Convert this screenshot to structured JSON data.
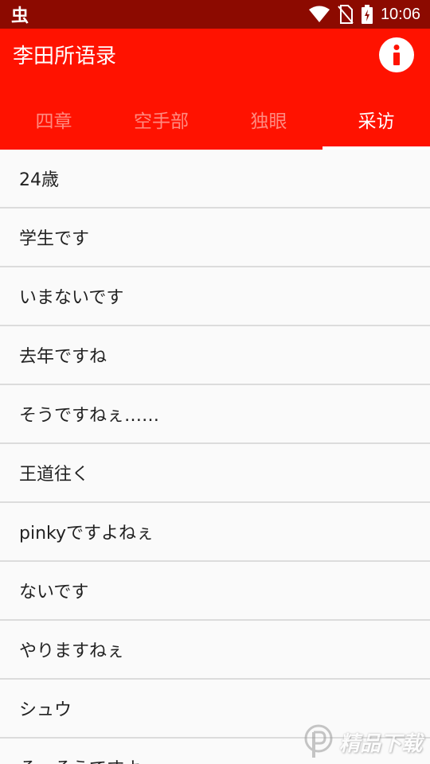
{
  "status_bar": {
    "notification_icon": "虫",
    "time": "10:06"
  },
  "app": {
    "title": "李田所语录",
    "info_icon": "info-icon"
  },
  "tabs": [
    {
      "label": "四章",
      "active": false
    },
    {
      "label": "空手部",
      "active": false
    },
    {
      "label": "独眼",
      "active": false
    },
    {
      "label": "采访",
      "active": true
    }
  ],
  "items": [
    {
      "label": "24歳"
    },
    {
      "label": "学生です"
    },
    {
      "label": "いまないです"
    },
    {
      "label": "去年ですね"
    },
    {
      "label": "そうですねぇ……"
    },
    {
      "label": "王道往く"
    },
    {
      "label": "pinkyですよねぇ"
    },
    {
      "label": "ないです"
    },
    {
      "label": "やりますねぇ"
    },
    {
      "label": "シュウ"
    },
    {
      "label": "そ、そうですよ"
    }
  ],
  "watermark": {
    "text": "精品下载"
  },
  "colors": {
    "status_bar": "#8c0a00",
    "app_bar": "#ff1200",
    "inactive_tab": "#ff8a80",
    "active_tab": "#ffffff",
    "list_bg": "#fafafa"
  }
}
